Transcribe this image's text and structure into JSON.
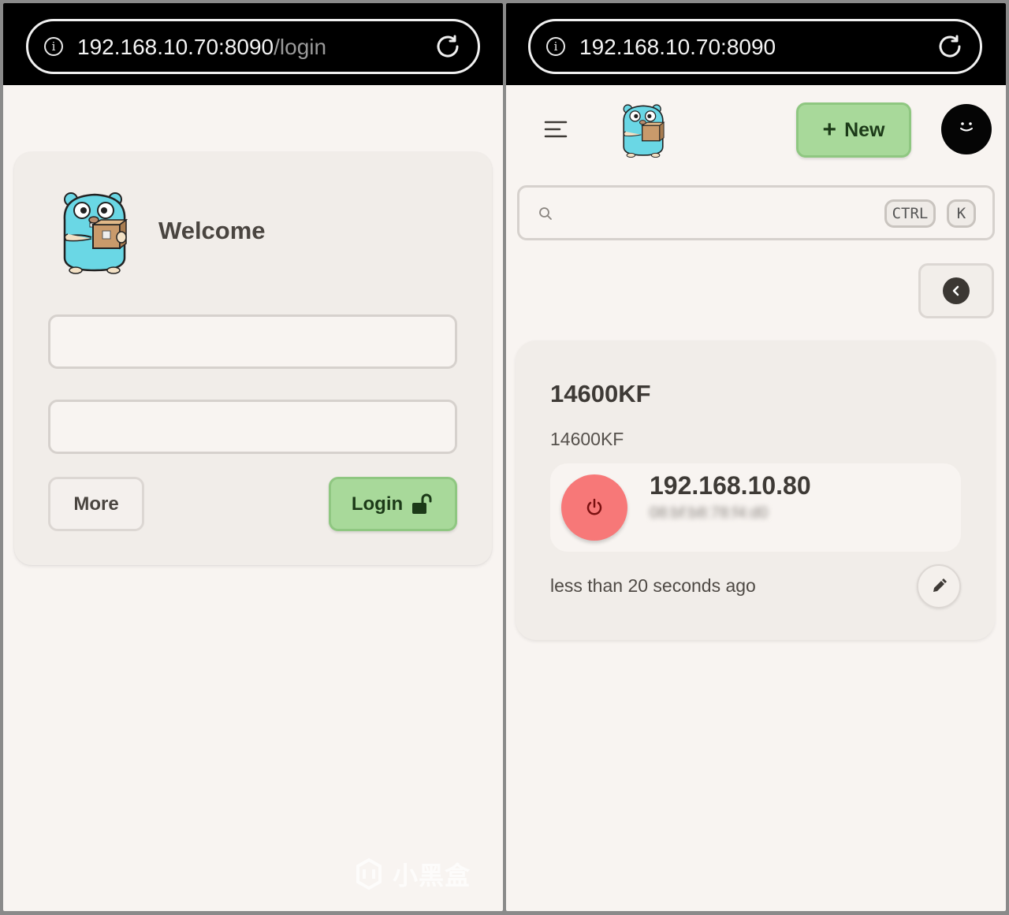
{
  "login_page": {
    "url_host": "192.168.10.70:8090",
    "url_path": "/login",
    "welcome": "Welcome",
    "username_value": "",
    "password_value": "",
    "more_label": "More",
    "login_label": "Login",
    "icons": [
      "info-icon",
      "reload-icon",
      "gopher-logo",
      "unlock-icon"
    ]
  },
  "dashboard": {
    "url_host": "192.168.10.70:8090",
    "new_label": "New",
    "search": {
      "placeholder": "",
      "shortcut_ctrl": "CTRL",
      "shortcut_k": "K"
    },
    "device": {
      "name": "14600KF",
      "hostname": "14600KF",
      "ip": "192.168.10.80",
      "mac": "08:bf:b8:78:f4:d0",
      "last_seen": "less than 20 seconds ago",
      "status_color": "#f77878"
    },
    "icons": [
      "info-icon",
      "reload-icon",
      "menu-icon",
      "gopher-logo",
      "plus-icon",
      "avatar-icon",
      "search-icon",
      "chevron-left-icon",
      "power-icon",
      "pencil-icon"
    ]
  },
  "watermark": {
    "text": "小黑盒"
  },
  "colors": {
    "accent_green": "#a8d99a",
    "background": "#f8f4f1",
    "card": "#f1ede9",
    "power_red": "#f77878"
  }
}
